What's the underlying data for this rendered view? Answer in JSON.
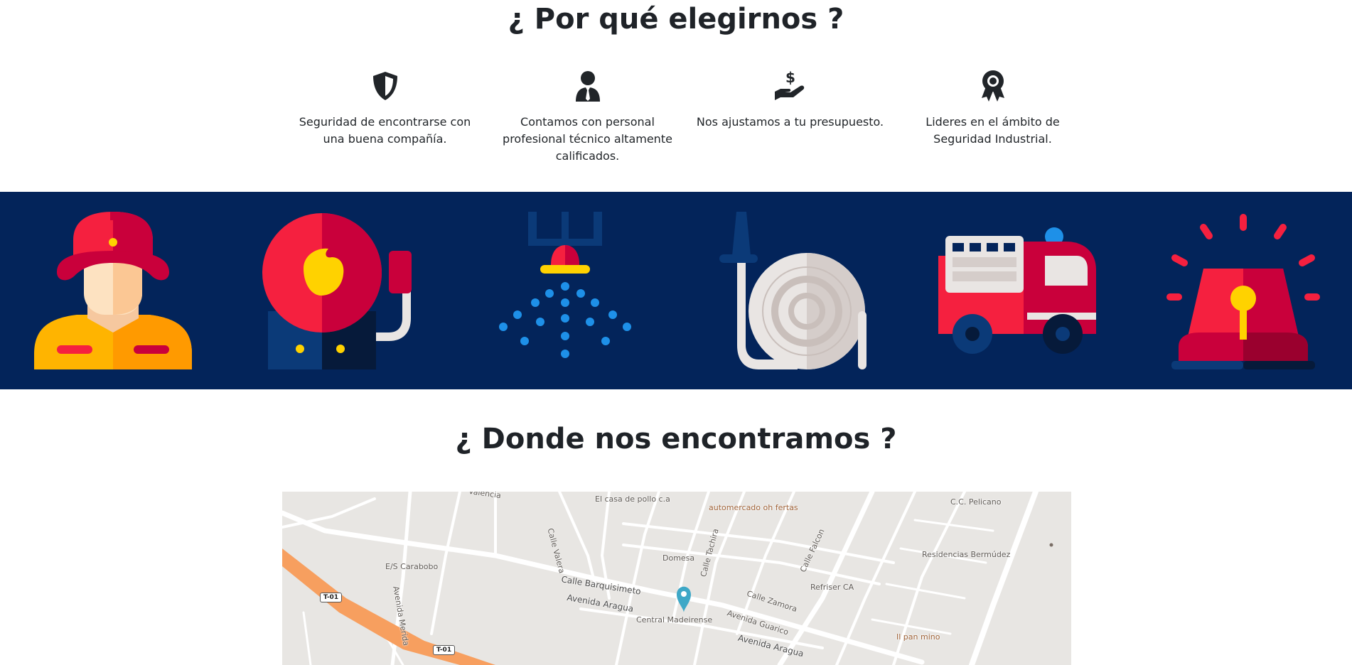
{
  "why_section": {
    "title": "¿ Por qué elegirnos ?",
    "features": [
      {
        "icon": "shield-icon",
        "text": "Seguridad de encontrarse con una buena compañía."
      },
      {
        "icon": "person-tie-icon",
        "text": "Contamos con personal profesional técnico altamente calificados."
      },
      {
        "icon": "hand-dollar-icon",
        "text": "Nos ajustamos a tu presupuesto."
      },
      {
        "icon": "award-icon",
        "text": "Lideres en el ámbito de Seguridad Industrial."
      }
    ]
  },
  "banner": {
    "icons": [
      "firefighter-icon",
      "fire-alarm-bell-icon",
      "sprinkler-icon",
      "fire-hose-icon",
      "fire-truck-icon",
      "alarm-siren-icon"
    ],
    "colors": {
      "background": "#03245a",
      "red": "#f5203f",
      "dark_red": "#c9003b",
      "yellow": "#ffd200",
      "blue": "#1e90e8"
    }
  },
  "location_section": {
    "title": "¿ Donde nos encontramos ?",
    "map": {
      "labels": {
        "valencia": "Valencia",
        "calle_valera": "Calle Valera",
        "casa_pollo": "El casa de pollo c.a",
        "automercado": "automercado oh fertas",
        "pelicano": "C.C. Pelicano",
        "domesa": "Domesa",
        "calle_tachira": "Calle Tachira",
        "calle_falcon": "Calle Falcon",
        "residencias": "Residencias Bermúdez",
        "es_carabobo": "E/S Carabobo",
        "calle_barquisimeto": "Calle Barquisimeto",
        "refriser": "Refriser CA",
        "avenida_merida": "Avenida Merida",
        "avenida_aragua_1": "Avenida Aragua",
        "avenida_aragua_2": "Avenida Aragua",
        "calle_zamora": "Calle Zamora",
        "central_madeirense": "Central Madeirense",
        "avenida_guarico": "Avenida Guarico",
        "il_pan_mino": "Il pan mino",
        "shield_t01_a": "T-01",
        "shield_t01_b": "T-01"
      }
    }
  }
}
